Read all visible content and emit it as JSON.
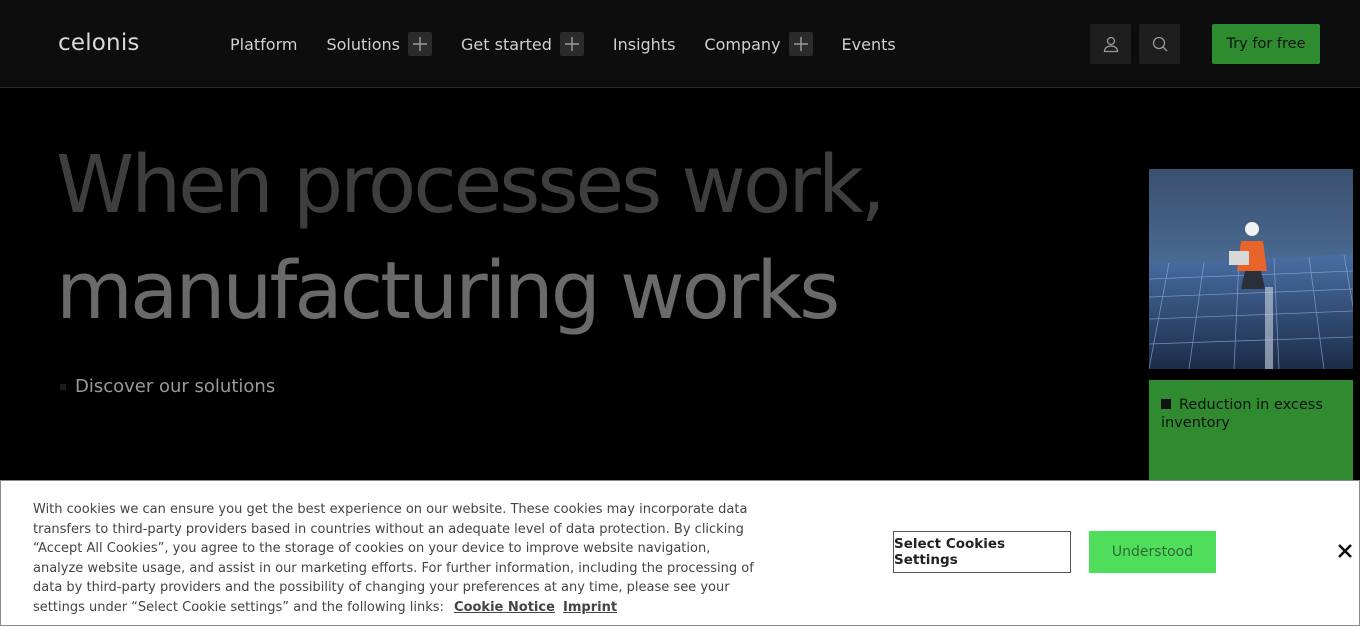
{
  "header": {
    "logo": "celonis",
    "nav": [
      {
        "label": "Platform"
      },
      {
        "label": "Solutions"
      },
      {
        "label": "Get started"
      },
      {
        "label": "Insights"
      },
      {
        "label": "Company"
      },
      {
        "label": "Events"
      }
    ],
    "cta": "Try for free"
  },
  "hero": {
    "line1": "When processes work,",
    "line2": "manufacturing works",
    "discover": "Discover our solutions"
  },
  "card": {
    "stat": "Reduction in excess inventory"
  },
  "cookie": {
    "text": "With cookies we can ensure you get the best experience on our website. These cookies may incorporate data transfers to third-party providers based in countries without an adequate level of data protection. By clicking “Accept All Cookies”, you agree to the storage of cookies on your device to improve website navigation, analyze website usage, and assist in our marketing efforts. For further information, including the processing of data by third-party providers and the possibility of changing your preferences at any time, please see your settings under “Select Cookie settings” and the following links:",
    "link1": "Cookie Notice",
    "link2": "Imprint",
    "settings_button": "Select Cookies Settings",
    "accept_button": "Understood"
  },
  "colors": {
    "cta_green": "#2e8b2e",
    "accept_green": "#4ede5c",
    "card_green": "#2f8a30"
  }
}
